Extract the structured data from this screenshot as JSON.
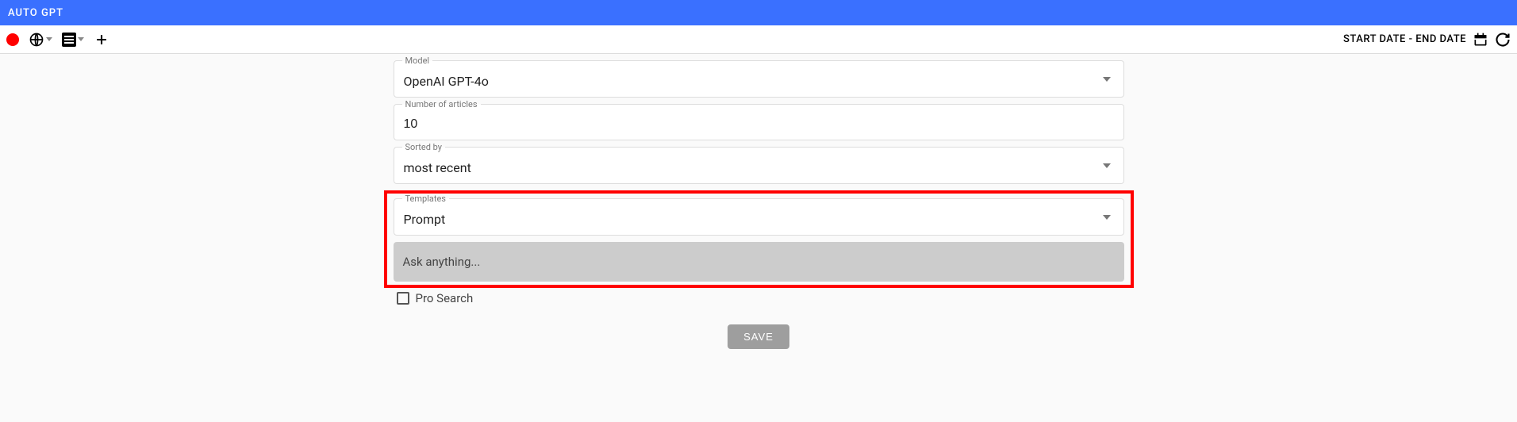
{
  "header": {
    "title": "AUTO GPT"
  },
  "toolbar": {
    "date_range_label": "START DATE - END DATE"
  },
  "form": {
    "model": {
      "label": "Model",
      "value": "OpenAI GPT-4o"
    },
    "num_articles": {
      "label": "Number of articles",
      "value": "10"
    },
    "sorted_by": {
      "label": "Sorted by",
      "value": "most recent"
    },
    "templates": {
      "label": "Templates",
      "value": "Prompt"
    },
    "prompt": {
      "placeholder": "Ask anything..."
    },
    "pro_search_label": "Pro Search",
    "save_label": "SAVE"
  }
}
